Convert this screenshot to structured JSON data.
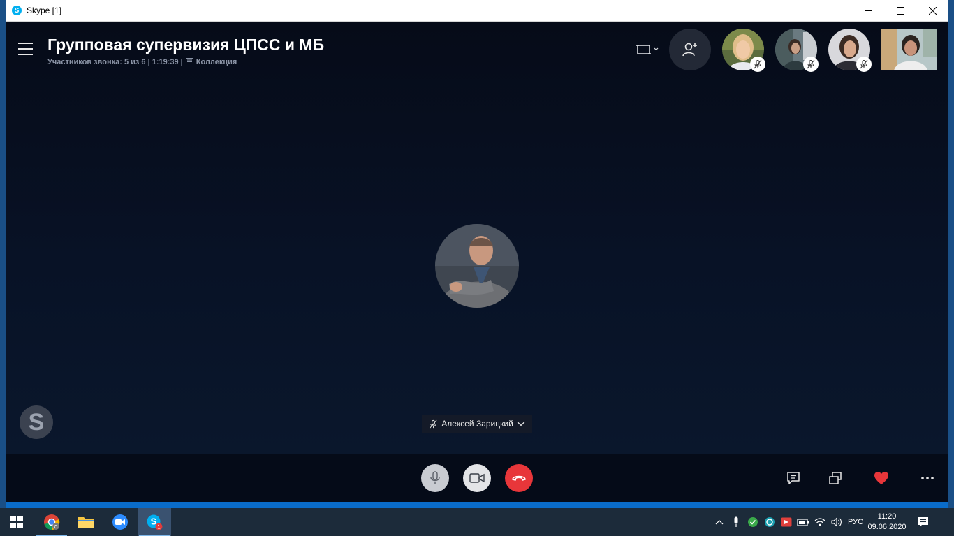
{
  "window": {
    "title": "Skype [1]"
  },
  "call": {
    "title": "Групповая супервизия ЦПСС и МБ",
    "subtitle": "Участников звонка: 5 из 6 | 1:19:39 |",
    "gallery_label": "Коллекция",
    "speaker_name": "Алексей Зарицкий"
  },
  "skype_logo_letter": "S",
  "taskbar": {
    "chrome_badge": "C",
    "skype_badge": "1",
    "language": "РУС",
    "time": "11:20",
    "date": "09.06.2020"
  },
  "colors": {
    "accent": "#00aff0",
    "hangup": "#e8363a",
    "heart": "#e8363a",
    "call_bg": "#070d1c"
  }
}
